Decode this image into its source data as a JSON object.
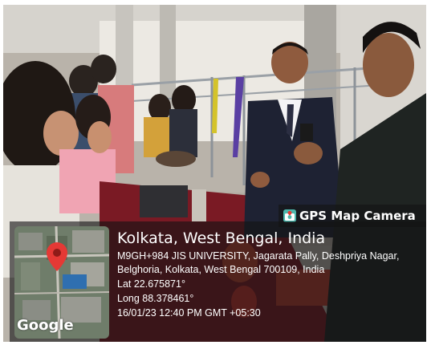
{
  "badge": {
    "label": "GPS Map Camera",
    "icon": "map-camera-icon"
  },
  "location": {
    "title": "Kolkata, West Bengal, India",
    "address": "M9GH+984 JIS UNIVERSITY, Jagarata Pally, Deshpriya Nagar, Belghoria, Kolkata, West Bengal 700109, India",
    "lat": "Lat 22.675871°",
    "long": "Long 88.378461°",
    "datetime": "16/01/23 12:40 PM GMT +05:30"
  },
  "map": {
    "watermark": "Google",
    "pin_color": "#e53935"
  }
}
